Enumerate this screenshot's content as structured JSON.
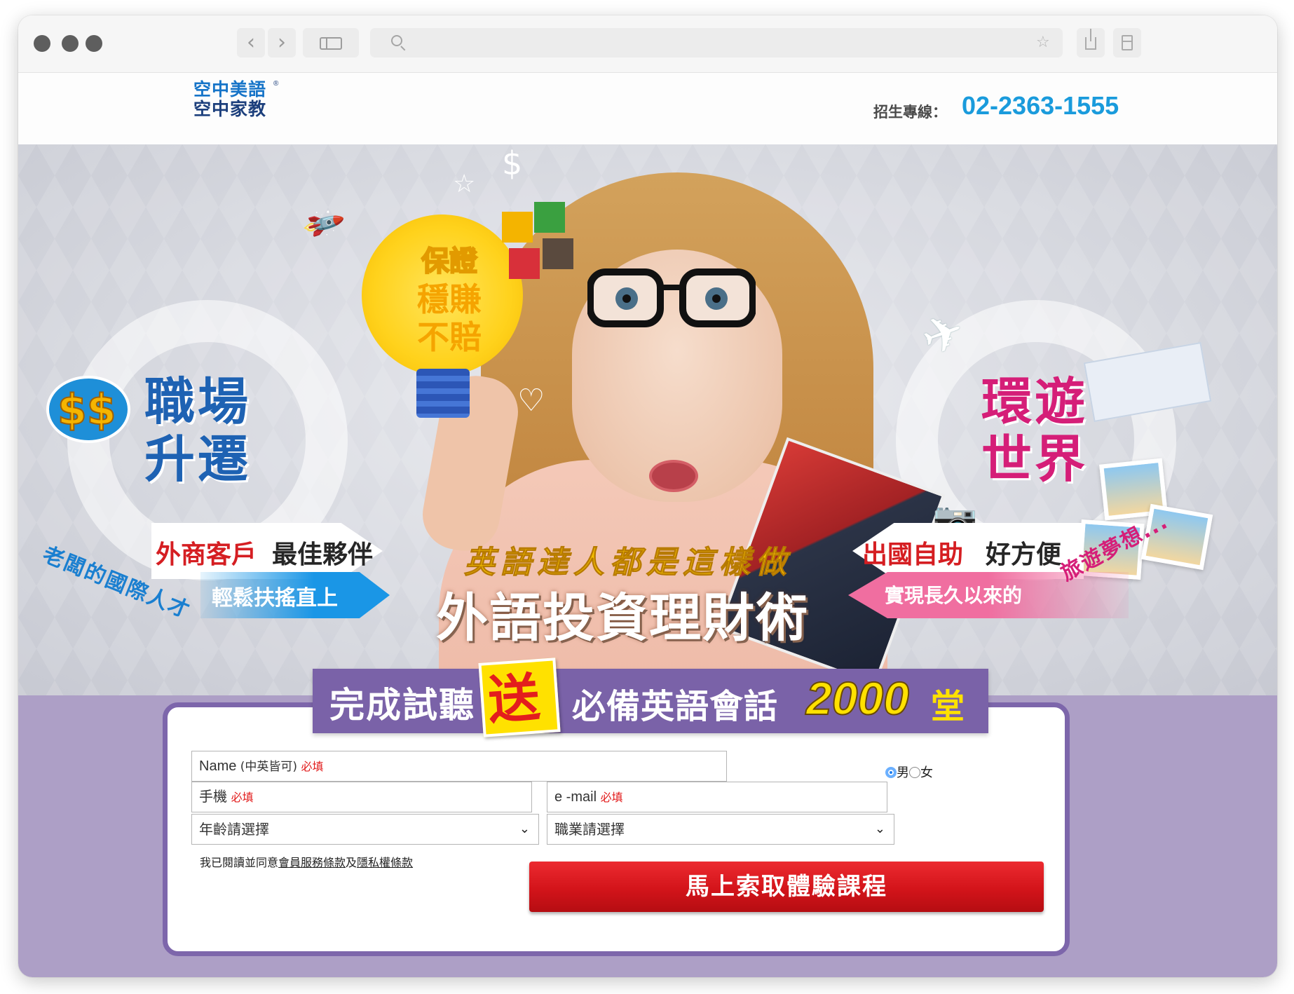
{
  "browser": {
    "back_icon": "chevron-left-icon",
    "forward_icon": "chevron-right-icon",
    "back_glyph": "‹",
    "forward_glyph": "›",
    "star_glyph": "☆",
    "address": ""
  },
  "header": {
    "logo_line1": "空中美語",
    "logo_line2": "空中家教",
    "logo_reg": "®",
    "hotline_label": "招生專線：",
    "hotline_number": "02-2363-1555"
  },
  "hero": {
    "bulb_line1": "保證",
    "bulb_line2": "穩賺",
    "bulb_line3": "不賠",
    "left_title_1": "職場",
    "left_title_2": "升遷",
    "left_money": "$$",
    "left_tag_red": "外商客戶",
    "left_tag_dark": "最佳夥伴",
    "left_arc": "老闆的國際人才",
    "left_arrow_text": "輕鬆扶搖直上",
    "right_title_1": "環遊",
    "right_title_2": "世界",
    "right_tag_red": "出國自助",
    "right_tag_dark": "好方便",
    "right_arrow_text": "實現長久以來的",
    "right_arc": "旅遊夢想...",
    "headline_sub": "英語達人都是這樣做",
    "headline_main": "外語投資理財術",
    "deco_plane": "✈",
    "deco_rocket": "🚀",
    "deco_heart": "♡",
    "deco_dollar": "$",
    "deco_star": "☆",
    "deco_camera": "📷"
  },
  "promo": {
    "part1": "完成試聽",
    "badge": "送",
    "part2": "必備英語會話",
    "number": "2000",
    "unit": "堂"
  },
  "form": {
    "name_label": "Name",
    "name_hint": " (中英皆可) ",
    "required": "必填",
    "gender_male": "男",
    "gender_female": "女",
    "gender_selected": "男",
    "phone_label": "手機",
    "email_label": "e -mail",
    "age_select": "年齡請選擇",
    "job_select": "職業請選擇",
    "select_chevron": "⌄",
    "agree_prefix": "我已閱讀並同意",
    "terms_link": "會員服務條款",
    "and": "及",
    "privacy_link": "隱私權條款",
    "submit_label": "馬上索取體驗課程"
  },
  "colors": {
    "brand_blue": "#1a9bdc",
    "purple_band": "#ad9fc6",
    "promo_purple": "#7a62a8",
    "submit_red": "#d3141a",
    "required_red": "#e21b1b",
    "left_title_blue": "#1e62b3",
    "right_title_pink": "#d51e78"
  }
}
